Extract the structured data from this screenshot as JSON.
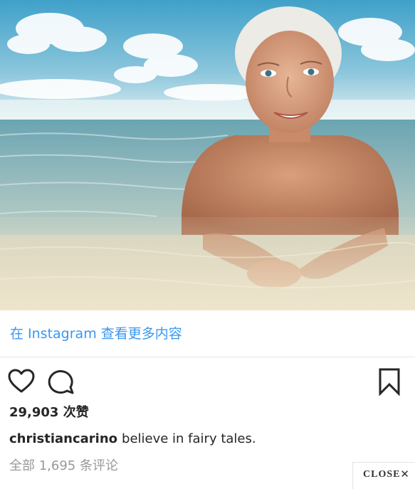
{
  "photo": {
    "description_alt": "",
    "colors": {
      "sky_top": "#4fa9cf",
      "sky_bottom": "#d8ecf1",
      "sea_deep": "#5f9fae",
      "sea_shallow": "#c6d6cc",
      "sand": "#e9dcc3",
      "skin": "#c98a68",
      "hair": "#ecebe6"
    }
  },
  "view_more": {
    "label": "在 Instagram 查看更多内容"
  },
  "actions": {
    "like_icon": "heart-icon",
    "comment_icon": "comment-icon",
    "save_icon": "bookmark-icon"
  },
  "likes": {
    "text": "29,903 次赞"
  },
  "caption": {
    "username": "christiancarino",
    "text": "believe in fairy tales."
  },
  "comments": {
    "text": "全部 1,695 条评论"
  },
  "close": {
    "label": "CLOSE",
    "icon": "close-icon",
    "glyph": "✕"
  }
}
